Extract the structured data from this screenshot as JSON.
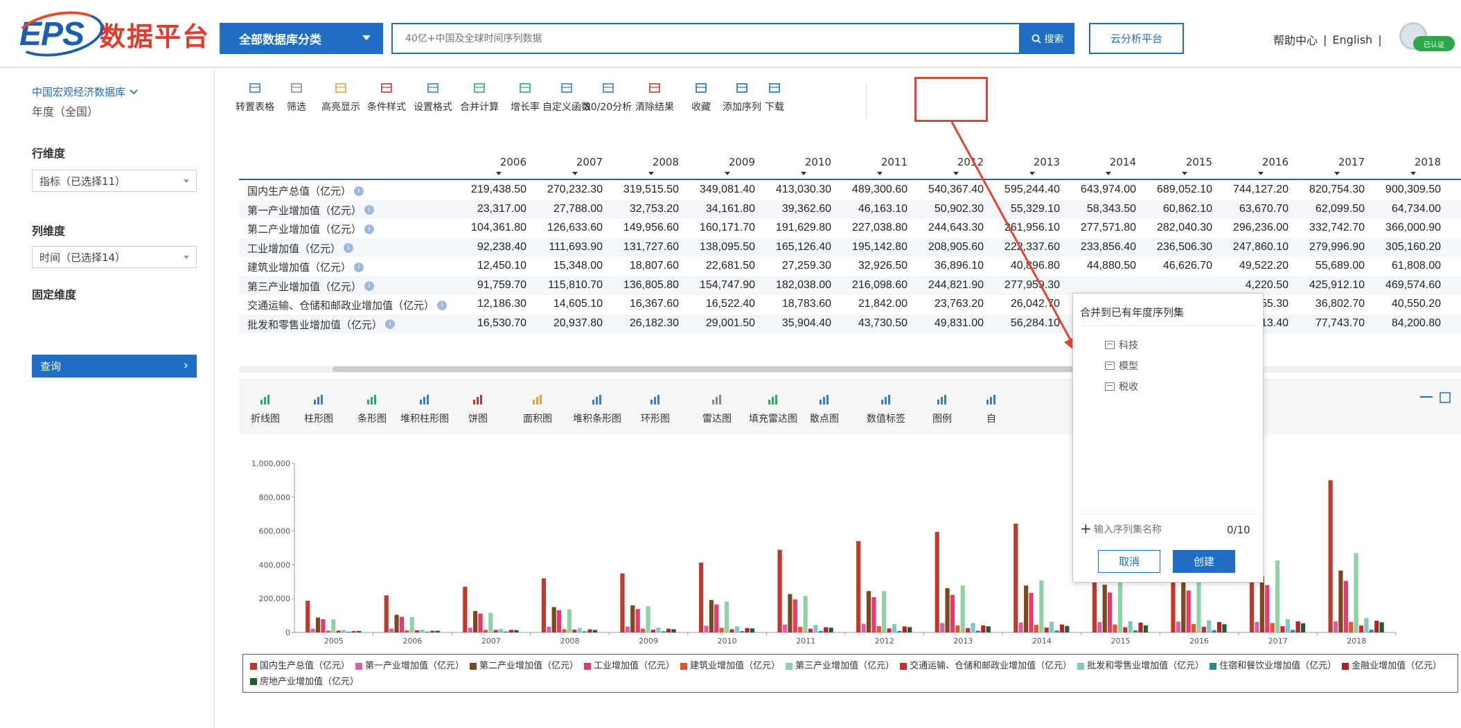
{
  "header": {
    "logo": "EPS",
    "platform_name": "数据平台",
    "category_button": "全部数据库分类",
    "search_placeholder": "40亿+中国及全球时间序列数据",
    "search_button": "搜索",
    "cloud_button": "云分析平台",
    "help_link": "帮助中心",
    "separator": "|",
    "english_link": "English",
    "badge": "已认证"
  },
  "sidebar": {
    "database": "中国宏观经济数据库",
    "frequency": "年度（全国）",
    "row_dim_label": "行维度",
    "row_dim_value": "指标（已选择11）",
    "col_dim_label": "列维度",
    "col_dim_value": "时间（已选择14）",
    "fixed_dim_label": "固定维度",
    "query_button": "查询",
    "query_arrow": "›"
  },
  "toolbar": [
    {
      "label": "转置表格",
      "icon": "transpose-icon"
    },
    {
      "label": "筛选",
      "icon": "filter-icon"
    },
    {
      "label": "高亮显示",
      "icon": "highlight-icon"
    },
    {
      "label": "条件样式",
      "icon": "condition-style-icon"
    },
    {
      "label": "设置格式",
      "icon": "format-icon"
    },
    {
      "label": "合并计算",
      "icon": "merge-calc-icon"
    },
    {
      "label": "增长率",
      "icon": "growth-rate-icon"
    },
    {
      "label": "自定义函数",
      "icon": "function-icon"
    },
    {
      "label": "80/20分析",
      "icon": "pareto-icon"
    },
    {
      "label": "清除结果",
      "icon": "clear-icon"
    },
    {
      "label": "收藏",
      "icon": "star-icon"
    },
    {
      "label": "添加序列",
      "icon": "add-series-icon"
    },
    {
      "label": "下载",
      "icon": "download-icon"
    }
  ],
  "table": {
    "years": [
      "2006",
      "2007",
      "2008",
      "2009",
      "2010",
      "2011",
      "2012",
      "2013",
      "2014",
      "2015",
      "2016",
      "2017",
      "2018"
    ],
    "rows": [
      {
        "label": "国内生产总值（亿元）",
        "values": [
          "219,438.50",
          "270,232.30",
          "319,515.50",
          "349,081.40",
          "413,030.30",
          "489,300.60",
          "540,367.40",
          "595,244.40",
          "643,974.00",
          "689,052.10",
          "744,127.20",
          "820,754.30",
          "900,309.50"
        ]
      },
      {
        "label": "第一产业增加值（亿元）",
        "values": [
          "23,317.00",
          "27,788.00",
          "32,753.20",
          "34,161.80",
          "39,362.60",
          "46,163.10",
          "50,902.30",
          "55,329.10",
          "58,343.50",
          "60,862.10",
          "63,670.70",
          "62,099.50",
          "64,734.00"
        ]
      },
      {
        "label": "第二产业增加值（亿元）",
        "values": [
          "104,361.80",
          "126,633.60",
          "149,956.60",
          "160,171.70",
          "191,629.80",
          "227,038.80",
          "244,643.30",
          "261,956.10",
          "277,571.80",
          "282,040.30",
          "296,236.00",
          "332,742.70",
          "366,000.90"
        ]
      },
      {
        "label": "工业增加值（亿元）",
        "values": [
          "92,238.40",
          "111,693.90",
          "131,727.60",
          "138,095.50",
          "165,126.40",
          "195,142.80",
          "208,905.60",
          "222,337.60",
          "233,856.40",
          "236,506.30",
          "247,860.10",
          "279,996.90",
          "305,160.20"
        ]
      },
      {
        "label": "建筑业增加值（亿元）",
        "values": [
          "12,450.10",
          "15,348.00",
          "18,807.60",
          "22,681.50",
          "27,259.30",
          "32,926.50",
          "36,896.10",
          "40,896.80",
          "44,880.50",
          "46,626.70",
          "49,522.20",
          "55,689.00",
          "61,808.00"
        ]
      },
      {
        "label": "第三产业增加值（亿元）",
        "values": [
          "91,759.70",
          "115,810.70",
          "136,805.80",
          "154,747.90",
          "182,038.00",
          "216,098.60",
          "244,821.90",
          "277,959.30",
          "",
          "",
          "4,220.50",
          "425,912.10",
          "469,574.60"
        ]
      },
      {
        "label": "交通运输、仓储和邮政业增加值（亿元）",
        "values": [
          "12,186.30",
          "14,605.10",
          "16,367.60",
          "16,522.40",
          "18,783.60",
          "21,842.00",
          "23,763.20",
          "26,042.70",
          "",
          "",
          "3,355.30",
          "36,802.70",
          "40,550.20"
        ]
      },
      {
        "label": "批发和零售业增加值（亿元）",
        "values": [
          "16,530.70",
          "20,937.80",
          "26,182.30",
          "29,001.50",
          "35,904.40",
          "43,730.50",
          "49,831.00",
          "56,284.10",
          "",
          "",
          "1,113.40",
          "77,743.70",
          "84,200.80"
        ]
      }
    ]
  },
  "chart_toolbar": [
    {
      "label": "折线图",
      "icon": "line-chart-icon"
    },
    {
      "label": "柱形图",
      "icon": "column-chart-icon"
    },
    {
      "label": "条形图",
      "icon": "bar-chart-icon"
    },
    {
      "label": "堆积柱形图",
      "icon": "stacked-column-icon"
    },
    {
      "label": "饼图",
      "icon": "pie-chart-icon"
    },
    {
      "label": "面积图",
      "icon": "area-chart-icon"
    },
    {
      "label": "堆积条形图",
      "icon": "stacked-bar-icon"
    },
    {
      "label": "环形图",
      "icon": "donut-chart-icon"
    },
    {
      "label": "雷达图",
      "icon": "radar-chart-icon"
    },
    {
      "label": "填充雷达图",
      "icon": "filled-radar-icon"
    },
    {
      "label": "散点图",
      "icon": "scatter-chart-icon"
    },
    {
      "label": "数值标签",
      "icon": "value-label-icon"
    },
    {
      "label": "图例",
      "icon": "legend-icon"
    },
    {
      "label": "自",
      "icon": "custom-icon"
    }
  ],
  "chart_data": {
    "type": "bar",
    "categories": [
      "2005",
      "2006",
      "2007",
      "2008",
      "2009",
      "2010",
      "2011",
      "2012",
      "2013",
      "2014",
      "2015",
      "2016",
      "2017",
      "2018"
    ],
    "ylim": [
      0,
      1000000
    ],
    "yticks": [
      "0",
      "200,000",
      "400,000",
      "600,000",
      "800,000",
      "1,000,000"
    ],
    "series": [
      {
        "name": "国内生产总值（亿元）",
        "color": "#c0392b",
        "values": [
          187319,
          219438.5,
          270232.3,
          319515.5,
          349081.4,
          413030.3,
          489300.6,
          540367.4,
          595244.4,
          643974,
          689052.1,
          744127.2,
          820754.3,
          900309.5
        ]
      },
      {
        "name": "第一产业增加值（亿元）",
        "color": "#d65fa8",
        "values": [
          21806,
          23317,
          27788,
          32753.2,
          34161.8,
          39362.6,
          46163.1,
          50902.3,
          55329.1,
          58343.5,
          60862.1,
          63670.7,
          62099.5,
          64734
        ]
      },
      {
        "name": "第二产业增加值（亿元）",
        "color": "#7a4a1c",
        "values": [
          88084,
          104361.8,
          126633.6,
          149956.6,
          160171.7,
          191629.8,
          227038.8,
          244643.3,
          261956.1,
          277571.8,
          282040.3,
          296236,
          332742.7,
          366000.9
        ]
      },
      {
        "name": "工业增加值（亿元）",
        "color": "#e8386d",
        "values": [
          77958,
          92238.4,
          111693.9,
          131727.6,
          138095.5,
          165126.4,
          195142.8,
          208905.6,
          222337.6,
          233856.4,
          236506.3,
          247860.1,
          279996.9,
          305160.2
        ]
      },
      {
        "name": "建筑业增加值（亿元）",
        "color": "#e8542a",
        "values": [
          10400,
          12450.1,
          15348,
          18807.6,
          22681.5,
          27259.3,
          32926.5,
          36896.1,
          40896.8,
          44880.5,
          46626.7,
          49522.2,
          55689,
          61808
        ]
      },
      {
        "name": "第三产业增加值（亿元）",
        "color": "#8ed2a6",
        "values": [
          77430,
          91759.7,
          115810.7,
          136805.8,
          154747.9,
          182038,
          216098.6,
          244821.9,
          277959.3,
          308058.6,
          346178,
          384220.5,
          425912.1,
          469574.6
        ]
      },
      {
        "name": "交通运输、仓储和邮政业增加值（亿元）",
        "color": "#c62d2d",
        "values": [
          10700,
          12186.3,
          14605.1,
          16367.6,
          16522.4,
          18783.6,
          21842,
          23763.2,
          26042.7,
          28500.9,
          30487.8,
          33355.3,
          36802.7,
          40550.2
        ]
      },
      {
        "name": "批发和零售业增加值（亿元）",
        "color": "#7fc8c4",
        "values": [
          13966,
          16530.7,
          20937.8,
          26182.3,
          29001.5,
          35904.4,
          43730.5,
          49831,
          56284.1,
          62423.5,
          66186.7,
          71113.4,
          77743.7,
          84200.8
        ]
      },
      {
        "name": "住宿和餐饮业增加值（亿元）",
        "color": "#2e8b8b",
        "values": [
          4195,
          4792.6,
          5548.1,
          6616.1,
          6955.8,
          7712,
          8565.4,
          9536.9,
          10228.3,
          11158.5,
          12153.7,
          13358.2,
          14696.4,
          16023
        ]
      },
      {
        "name": "金融业增加值（亿元）",
        "color": "#b22222",
        "values": [
          7469,
          9951.7,
          15173.7,
          18313.4,
          21798.1,
          25680.4,
          30678.9,
          35188.4,
          41191,
          46665.2,
          57872.6,
          61121.7,
          65395,
          69100
        ]
      },
      {
        "name": "房地产业增加值（亿元）",
        "color": "#1e5e2e",
        "values": [
          8517,
          10370.5,
          13809.7,
          14738.7,
          18966.9,
          23569.9,
          28167.6,
          31248.3,
          35987.6,
          38000.8,
          41701,
          48190.9,
          53850.4,
          59846
        ]
      }
    ]
  },
  "popup": {
    "title": "合并到已有年度序列集",
    "items": [
      "科技",
      "模型",
      "税收"
    ],
    "plus": "+",
    "new_placeholder": "输入序列集名称",
    "counter": "0/10",
    "cancel": "取消",
    "create": "创建"
  }
}
